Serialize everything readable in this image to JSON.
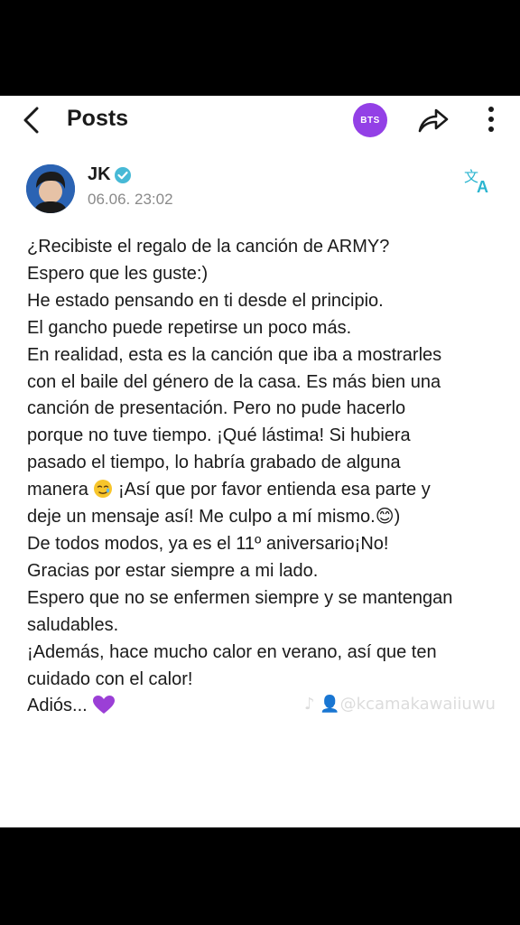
{
  "header": {
    "title": "Posts",
    "badge_label": "BTS",
    "badge_color": "#9340e6",
    "icons": [
      "back-arrow-icon",
      "share-icon",
      "more-vertical-icon"
    ]
  },
  "post": {
    "author_name": "JK",
    "verified_color": "#47b9d6",
    "timestamp": "06.06. 23:02",
    "translate_icon": "translate-icon",
    "lines": [
      "¿Recibiste el regalo de la canción de ARMY?",
      "Espero que les guste:)",
      "He estado pensando en ti desde el principio.",
      "El gancho puede repetirse un poco más.",
      "En realidad, esta es la canción que iba a mostrarles",
      "con el baile del género de la casa. Es más bien una",
      "canción de presentación. Pero no pude hacerlo",
      "porque no tuve tiempo. ¡Qué lástima! Si hubiera",
      "pasado el tiempo, lo habría grabado de alguna"
    ],
    "line_manera_before": "manera",
    "line_manera_after": "¡Así que por favor entienda esa parte y",
    "lines_after": [
      "deje un mensaje así! Me culpo a mí mismo.😊)",
      "De todos modos, ya es el 11º aniversario¡No!",
      "Gracias por estar siempre a mi lado.",
      "Espero que no se enfermen siempre y se mantengan",
      "saludables.",
      "¡Además, hace mucho calor en verano, así que ten",
      "cuidado con el calor!"
    ],
    "last_line": "Adiós...",
    "heart_color": "#9b3fd6"
  },
  "watermark": "♪ 👤@kcamakawaiiuwu"
}
